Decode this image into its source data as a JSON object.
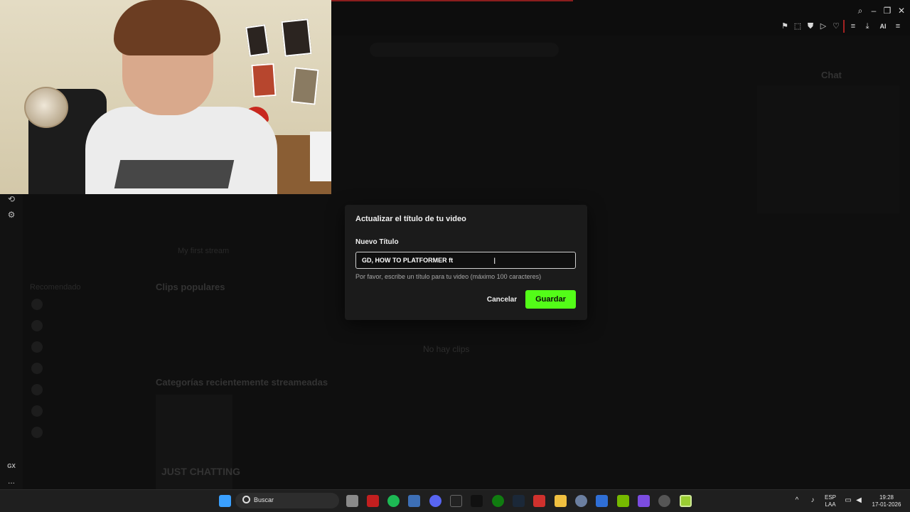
{
  "modal": {
    "title": "Actualizar el título de tu video",
    "field_label": "Nuevo Título",
    "input_value": "GD, HOW TO PLATFORMER ft",
    "hint": "Por favor, escribe un título para tu video (máximo 100 caracteres)",
    "cancel_label": "Cancelar",
    "save_label": "Guardar"
  },
  "browser_toolbar": {
    "ai_label": "AI",
    "icons": [
      "bookmark-icon",
      "snapshot-icon",
      "shield-icon",
      "play-icon",
      "heart-icon",
      "download-icon",
      "ai-icon",
      "menu-icon"
    ],
    "window_icons": [
      "search-icon",
      "minimize-icon",
      "restore-icon",
      "close-icon"
    ]
  },
  "left_rail": {
    "gx_label": "GX",
    "more_label": "..."
  },
  "background": {
    "clips_heading": "Clips populares",
    "no_clips": "No hay clips",
    "categories_heading": "Categorías recientemente streameadas",
    "recommended_heading": "Recomendado",
    "chat_heading": "Chat",
    "stream_title": "My first stream",
    "category_card": "JUST CHATTING"
  },
  "taskbar": {
    "search_placeholder": "Buscar",
    "language_top": "ESP",
    "language_bottom": "LAA",
    "time": "19:28",
    "date": "17-01-2026"
  },
  "colors": {
    "accent": "#53fc18",
    "modal_bg": "#1b1b1b",
    "page_bg": "#0a0a0a"
  }
}
